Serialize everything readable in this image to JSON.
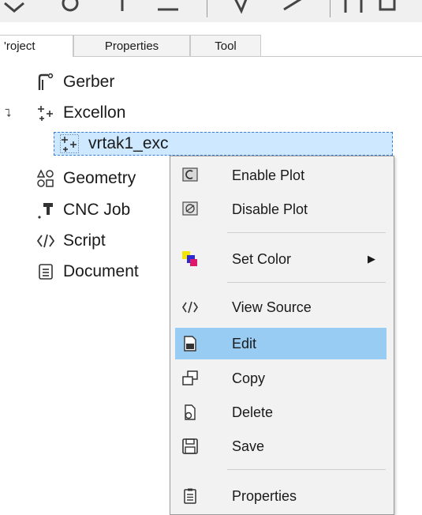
{
  "tabs": [
    {
      "label": "Project",
      "visible_label": "'roject"
    },
    {
      "label": "Properties"
    },
    {
      "label": "Tool"
    }
  ],
  "tree": {
    "items": [
      {
        "label": "Gerber",
        "icon": "gerber-icon"
      },
      {
        "label": "Excellon",
        "icon": "excellon-icon"
      },
      {
        "label": "vrtak1_exc",
        "icon": "excellon-object-icon"
      },
      {
        "label": "Geometry",
        "icon": "geometry-icon"
      },
      {
        "label": "CNC Job",
        "icon": "cnc-job-icon"
      },
      {
        "label": "Script",
        "icon": "script-icon"
      },
      {
        "label": "Document",
        "icon": "document-icon"
      }
    ]
  },
  "context_menu": {
    "items": [
      {
        "label": "Enable Plot",
        "icon": "enable-plot-icon"
      },
      {
        "label": "Disable Plot",
        "icon": "disable-plot-icon"
      },
      {
        "label": "Set Color",
        "icon": "set-color-icon",
        "submenu": "▶"
      },
      {
        "label": "View Source",
        "icon": "view-source-icon"
      },
      {
        "label": "Edit",
        "icon": "edit-icon",
        "highlighted": true
      },
      {
        "label": "Copy",
        "icon": "copy-icon"
      },
      {
        "label": "Delete",
        "icon": "delete-icon"
      },
      {
        "label": "Save",
        "icon": "save-icon"
      },
      {
        "label": "Properties",
        "icon": "properties-icon"
      }
    ]
  },
  "colors": {
    "selection": "#cde8ff",
    "menu_highlight": "#99ccf3",
    "menu_bg": "#f2f2f2"
  }
}
